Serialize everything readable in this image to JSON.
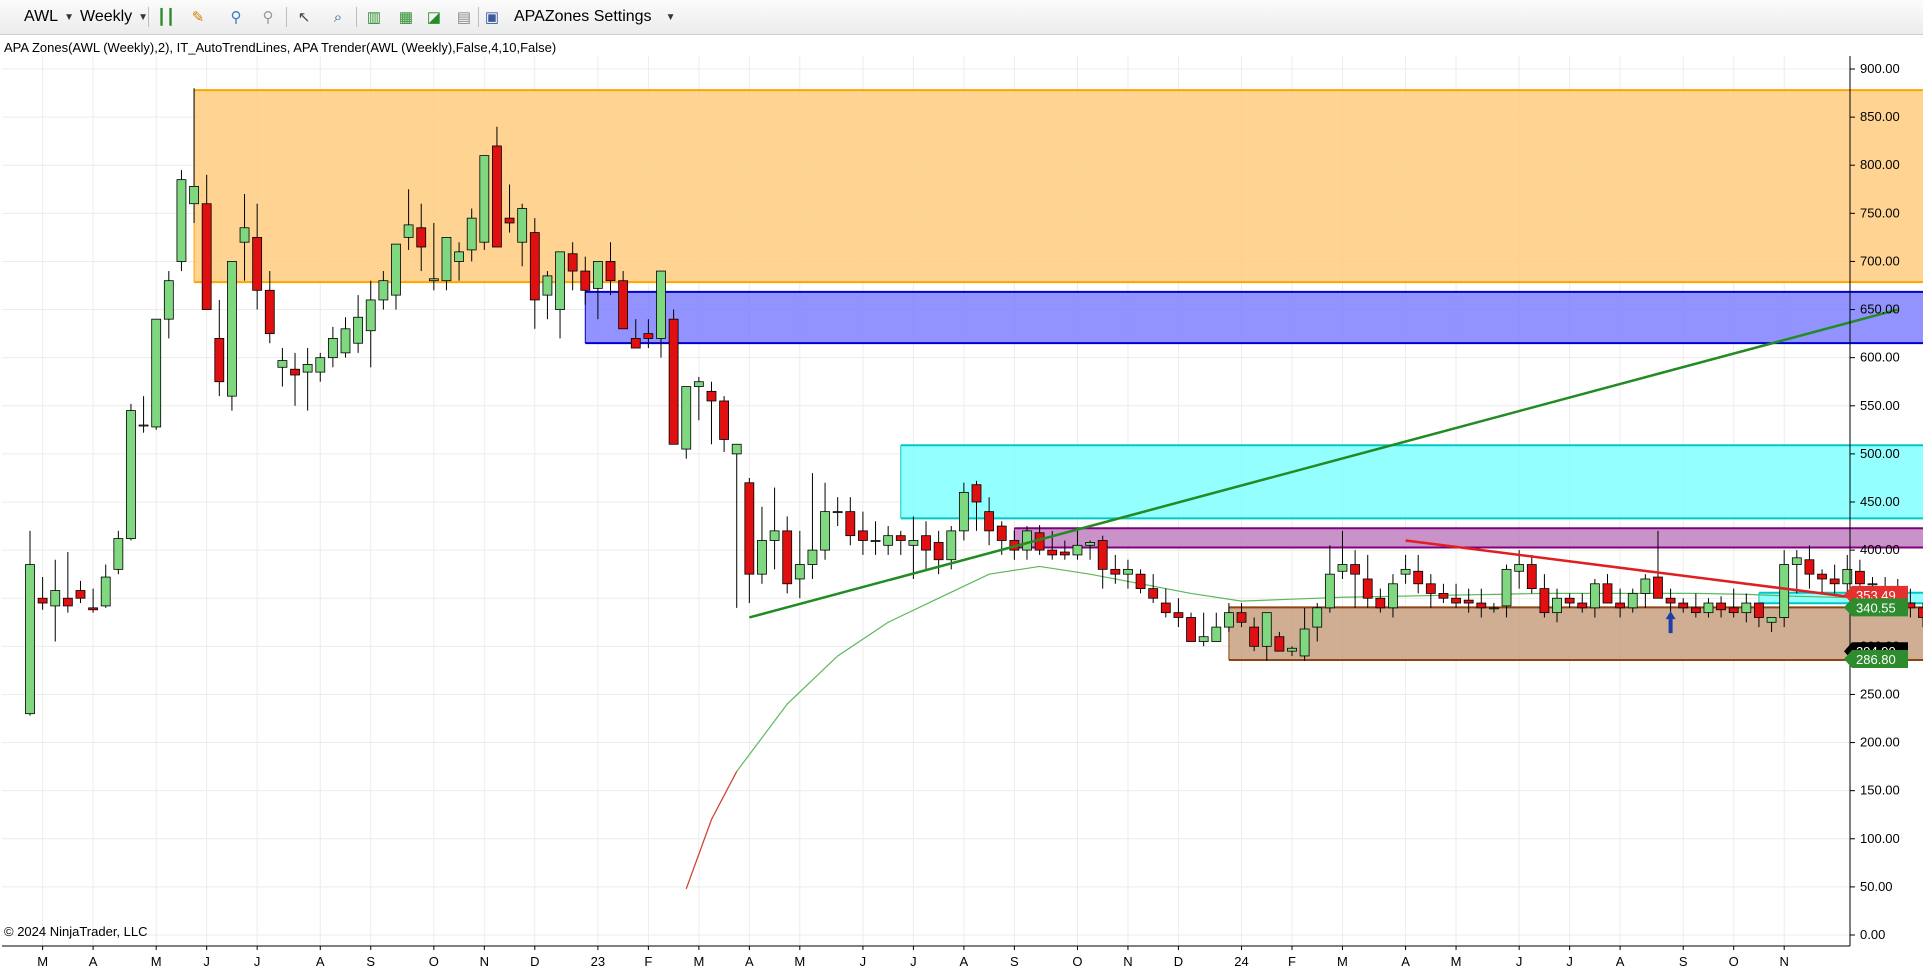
{
  "toolbar": {
    "instrument": "AWL",
    "period": "Weekly",
    "settings_label": "APAZones Settings",
    "icons": [
      "bar-type-icon",
      "pencil-draw-icon",
      "pin-icon",
      "pin-disabled-icon",
      "cursor-icon",
      "zoom-icon",
      "chart-style-icon",
      "data-box-icon",
      "line-chart-icon",
      "properties-icon",
      "apazones-settings-icon"
    ]
  },
  "indicator_label": "APA Zones(AWL (Weekly),2),  IT_AutoTrendLines, APA Trender(AWL (Weekly),False,4,10,False)",
  "copyright": "© 2024 NinjaTrader, LLC",
  "chart_data": {
    "type": "candlestick",
    "ylim": [
      0,
      925
    ],
    "y_ticks": [
      0,
      50,
      100,
      150,
      200,
      250,
      300,
      350,
      400,
      450,
      500,
      550,
      600,
      650,
      700,
      750,
      800,
      850,
      900
    ],
    "x_labels": [
      {
        "i": 1,
        "t": "M"
      },
      {
        "i": 5,
        "t": "A"
      },
      {
        "i": 10,
        "t": "M"
      },
      {
        "i": 14,
        "t": "J"
      },
      {
        "i": 18,
        "t": "J"
      },
      {
        "i": 23,
        "t": "A"
      },
      {
        "i": 27,
        "t": "S"
      },
      {
        "i": 32,
        "t": "O"
      },
      {
        "i": 36,
        "t": "N"
      },
      {
        "i": 40,
        "t": "D"
      },
      {
        "i": 45,
        "t": "23"
      },
      {
        "i": 49,
        "t": "F"
      },
      {
        "i": 53,
        "t": "M"
      },
      {
        "i": 57,
        "t": "A"
      },
      {
        "i": 61,
        "t": "M"
      },
      {
        "i": 66,
        "t": "J"
      },
      {
        "i": 70,
        "t": "J"
      },
      {
        "i": 74,
        "t": "A"
      },
      {
        "i": 78,
        "t": "S"
      },
      {
        "i": 83,
        "t": "O"
      },
      {
        "i": 87,
        "t": "N"
      },
      {
        "i": 91,
        "t": "D"
      },
      {
        "i": 96,
        "t": "24"
      },
      {
        "i": 100,
        "t": "F"
      },
      {
        "i": 104,
        "t": "M"
      },
      {
        "i": 109,
        "t": "A"
      },
      {
        "i": 113,
        "t": "M"
      },
      {
        "i": 118,
        "t": "J"
      },
      {
        "i": 122,
        "t": "J"
      },
      {
        "i": 126,
        "t": "A"
      },
      {
        "i": 131,
        "t": "S"
      },
      {
        "i": 135,
        "t": "O"
      },
      {
        "i": 139,
        "t": "N"
      }
    ],
    "ohlc": [
      [
        230,
        420,
        228,
        385
      ],
      [
        350,
        372,
        338,
        345
      ],
      [
        342,
        390,
        305,
        358
      ],
      [
        350,
        398,
        335,
        342
      ],
      [
        358,
        368,
        345,
        350
      ],
      [
        340,
        360,
        335,
        338
      ],
      [
        342,
        385,
        340,
        372
      ],
      [
        380,
        420,
        375,
        412
      ],
      [
        412,
        552,
        410,
        545
      ],
      [
        530,
        560,
        522,
        530
      ],
      [
        528,
        640,
        525,
        640
      ],
      [
        640,
        690,
        620,
        680
      ],
      [
        700,
        795,
        690,
        785
      ],
      [
        760,
        880,
        740,
        778
      ],
      [
        760,
        790,
        650,
        650
      ],
      [
        620,
        660,
        560,
        575
      ],
      [
        560,
        700,
        545,
        700
      ],
      [
        720,
        770,
        680,
        735
      ],
      [
        725,
        760,
        650,
        670
      ],
      [
        670,
        690,
        615,
        625
      ],
      [
        590,
        610,
        570,
        597
      ],
      [
        588,
        605,
        550,
        582
      ],
      [
        585,
        610,
        545,
        593
      ],
      [
        585,
        605,
        575,
        600
      ],
      [
        600,
        632,
        590,
        620
      ],
      [
        605,
        642,
        600,
        630
      ],
      [
        615,
        665,
        605,
        642
      ],
      [
        628,
        680,
        590,
        660
      ],
      [
        660,
        690,
        650,
        680
      ],
      [
        665,
        715,
        650,
        718
      ],
      [
        725,
        775,
        712,
        738
      ],
      [
        735,
        760,
        690,
        715
      ],
      [
        680,
        740,
        670,
        682
      ],
      [
        680,
        720,
        670,
        725
      ],
      [
        700,
        720,
        680,
        710
      ],
      [
        712,
        755,
        700,
        745
      ],
      [
        720,
        785,
        712,
        810
      ],
      [
        820,
        840,
        718,
        715
      ],
      [
        745,
        780,
        730,
        740
      ],
      [
        720,
        760,
        695,
        755
      ],
      [
        730,
        745,
        630,
        660
      ],
      [
        665,
        690,
        640,
        685
      ],
      [
        650,
        710,
        620,
        710
      ],
      [
        708,
        720,
        670,
        690
      ],
      [
        690,
        705,
        655,
        670
      ],
      [
        672,
        690,
        640,
        700
      ],
      [
        700,
        720,
        665,
        680
      ],
      [
        680,
        690,
        640,
        630
      ],
      [
        620,
        640,
        615,
        610
      ],
      [
        625,
        640,
        610,
        620
      ],
      [
        620,
        642,
        600,
        690
      ],
      [
        640,
        650,
        510,
        510
      ],
      [
        505,
        570,
        495,
        570
      ],
      [
        570,
        580,
        535,
        575
      ],
      [
        565,
        575,
        510,
        555
      ],
      [
        555,
        560,
        502,
        515
      ],
      [
        500,
        505,
        340,
        510
      ],
      [
        470,
        475,
        345,
        375
      ],
      [
        375,
        445,
        365,
        410
      ],
      [
        410,
        465,
        380,
        420
      ],
      [
        420,
        435,
        355,
        365
      ],
      [
        370,
        420,
        350,
        385
      ],
      [
        385,
        480,
        370,
        400
      ],
      [
        400,
        470,
        390,
        440
      ],
      [
        440,
        455,
        425,
        440
      ],
      [
        440,
        455,
        405,
        415
      ],
      [
        420,
        440,
        395,
        410
      ],
      [
        410,
        430,
        395,
        410
      ],
      [
        405,
        425,
        395,
        415
      ],
      [
        415,
        420,
        395,
        410
      ],
      [
        405,
        435,
        370,
        410
      ],
      [
        415,
        430,
        380,
        400
      ],
      [
        408,
        420,
        375,
        390
      ],
      [
        390,
        425,
        380,
        420
      ],
      [
        420,
        470,
        410,
        460
      ],
      [
        468,
        472,
        420,
        450
      ],
      [
        440,
        455,
        405,
        420
      ],
      [
        425,
        430,
        395,
        410
      ],
      [
        410,
        420,
        390,
        400
      ],
      [
        400,
        425,
        390,
        420
      ],
      [
        418,
        426,
        395,
        400
      ],
      [
        400,
        420,
        390,
        395
      ],
      [
        398,
        410,
        390,
        395
      ],
      [
        395,
        420,
        390,
        405
      ],
      [
        405,
        410,
        390,
        408
      ],
      [
        410,
        415,
        360,
        380
      ],
      [
        380,
        395,
        365,
        375
      ],
      [
        375,
        390,
        360,
        380
      ],
      [
        375,
        380,
        355,
        360
      ],
      [
        360,
        375,
        345,
        350
      ],
      [
        345,
        360,
        330,
        335
      ],
      [
        335,
        350,
        320,
        330
      ],
      [
        330,
        335,
        305,
        305
      ],
      [
        305,
        335,
        300,
        310
      ],
      [
        305,
        335,
        310,
        320
      ],
      [
        320,
        345,
        315,
        335
      ],
      [
        335,
        345,
        320,
        325
      ],
      [
        320,
        330,
        295,
        300
      ],
      [
        300,
        330,
        285,
        335
      ],
      [
        310,
        315,
        295,
        295
      ],
      [
        295,
        300,
        290,
        298
      ],
      [
        290,
        340,
        285,
        318
      ],
      [
        320,
        345,
        305,
        340
      ],
      [
        340,
        405,
        335,
        375
      ],
      [
        378,
        420,
        370,
        385
      ],
      [
        385,
        400,
        340,
        375
      ],
      [
        370,
        395,
        340,
        350
      ],
      [
        350,
        360,
        335,
        340
      ],
      [
        340,
        375,
        330,
        365
      ],
      [
        375,
        395,
        365,
        380
      ],
      [
        378,
        395,
        355,
        365
      ],
      [
        365,
        375,
        340,
        355
      ],
      [
        355,
        365,
        345,
        350
      ],
      [
        350,
        365,
        340,
        345
      ],
      [
        348,
        360,
        335,
        345
      ],
      [
        345,
        360,
        330,
        340
      ],
      [
        340,
        345,
        335,
        340
      ],
      [
        342,
        385,
        330,
        380
      ],
      [
        378,
        400,
        360,
        385
      ],
      [
        385,
        395,
        355,
        360
      ],
      [
        360,
        375,
        330,
        335
      ],
      [
        335,
        360,
        325,
        350
      ],
      [
        350,
        355,
        340,
        345
      ],
      [
        345,
        355,
        335,
        340
      ],
      [
        340,
        370,
        330,
        365
      ],
      [
        365,
        375,
        345,
        345
      ],
      [
        345,
        360,
        330,
        340
      ],
      [
        340,
        360,
        335,
        355
      ],
      [
        355,
        375,
        340,
        370
      ],
      [
        372,
        420,
        350,
        350
      ],
      [
        350,
        360,
        320,
        345
      ],
      [
        345,
        350,
        335,
        340
      ],
      [
        340,
        355,
        330,
        335
      ],
      [
        335,
        350,
        330,
        345
      ],
      [
        345,
        352,
        330,
        338
      ],
      [
        340,
        360,
        330,
        335
      ],
      [
        335,
        355,
        325,
        345
      ],
      [
        345,
        345,
        320,
        330
      ],
      [
        325,
        330,
        315,
        330
      ],
      [
        330,
        400,
        320,
        385
      ],
      [
        385,
        400,
        355,
        392
      ],
      [
        390,
        405,
        360,
        375
      ],
      [
        375,
        380,
        355,
        370
      ],
      [
        370,
        385,
        355,
        365
      ],
      [
        365,
        395,
        355,
        380
      ],
      [
        378,
        390,
        360,
        365
      ],
      [
        365,
        372,
        350,
        365
      ],
      [
        360,
        372,
        345,
        355
      ],
      [
        355,
        370,
        340,
        345
      ],
      [
        345,
        360,
        330,
        340
      ],
      [
        340,
        345,
        320,
        330
      ],
      [
        330,
        360,
        325,
        355
      ],
      [
        355,
        360,
        335,
        345
      ],
      [
        345,
        350,
        330,
        335
      ],
      [
        335,
        340,
        295,
        295
      ]
    ],
    "zones": [
      {
        "x0": 13,
        "top": 878,
        "bottom": 678.45,
        "fill": "#ffcc80",
        "stroke": "#ffa500",
        "label_top": "878.00",
        "label_bottom": "678.45"
      },
      {
        "x0": 44,
        "top": 668.4,
        "bottom": 615.05,
        "fill": "#8080ff",
        "stroke": "#0000cc",
        "label_top": "668.40",
        "label_bottom": "615.05"
      },
      {
        "x0": 69,
        "top": 509,
        "bottom": 433,
        "fill": "#80ffff",
        "stroke": "#00c8c8",
        "label_top": "509.00",
        "label_bottom": "433.00"
      },
      {
        "x0": 78,
        "top": 422.7,
        "bottom": 402.7,
        "fill": "#c080c0",
        "stroke": "#800080",
        "label_top": "422.70",
        "label_bottom": "402.70"
      },
      {
        "x0": 95,
        "top": 340.5,
        "bottom": 285.8,
        "fill": "#c8a080",
        "stroke": "#8b4513",
        "label_top": "340.55",
        "label_bottom": "285.80"
      },
      {
        "x0": 137,
        "top": 355.75,
        "bottom": 344.8,
        "fill": "#80ffff",
        "stroke": "#00c8c8",
        "label_top": "355.75",
        "label_bottom": "344.80"
      }
    ],
    "trendlines": [
      {
        "x0": 57,
        "y0": 330,
        "x1": 148,
        "y1": 650,
        "color": "#228b22"
      },
      {
        "x0": 109,
        "y0": 410,
        "x1": 148,
        "y1": 345,
        "color": "#e02020"
      }
    ],
    "ma_line": [
      [
        52,
        48
      ],
      [
        54,
        120
      ],
      [
        56,
        170
      ],
      [
        60,
        240
      ],
      [
        64,
        290
      ],
      [
        68,
        325
      ],
      [
        72,
        350
      ],
      [
        76,
        375
      ],
      [
        80,
        383
      ],
      [
        84,
        375
      ],
      [
        88,
        365
      ],
      [
        92,
        355
      ],
      [
        96,
        347
      ],
      [
        100,
        349
      ],
      [
        104,
        351
      ],
      [
        108,
        352
      ],
      [
        112,
        353
      ],
      [
        116,
        354
      ],
      [
        120,
        355
      ],
      [
        124,
        355
      ],
      [
        128,
        355
      ],
      [
        132,
        355
      ],
      [
        136,
        354
      ],
      [
        140,
        352
      ],
      [
        146,
        350
      ]
    ],
    "arrow_marker": {
      "i": 130,
      "price": 322,
      "color": "#1f3fa8"
    },
    "right_labels": [
      {
        "price": 353.49,
        "text": "353.49",
        "bg": "#e53030"
      },
      {
        "price": 340.55,
        "text": "340.55",
        "bg": "#2e8b2e"
      },
      {
        "price": 294.9,
        "text": "294.90",
        "bg": "#000000"
      },
      {
        "price": 286.8,
        "text": "286.80",
        "bg": "#2e8b2e"
      }
    ]
  }
}
